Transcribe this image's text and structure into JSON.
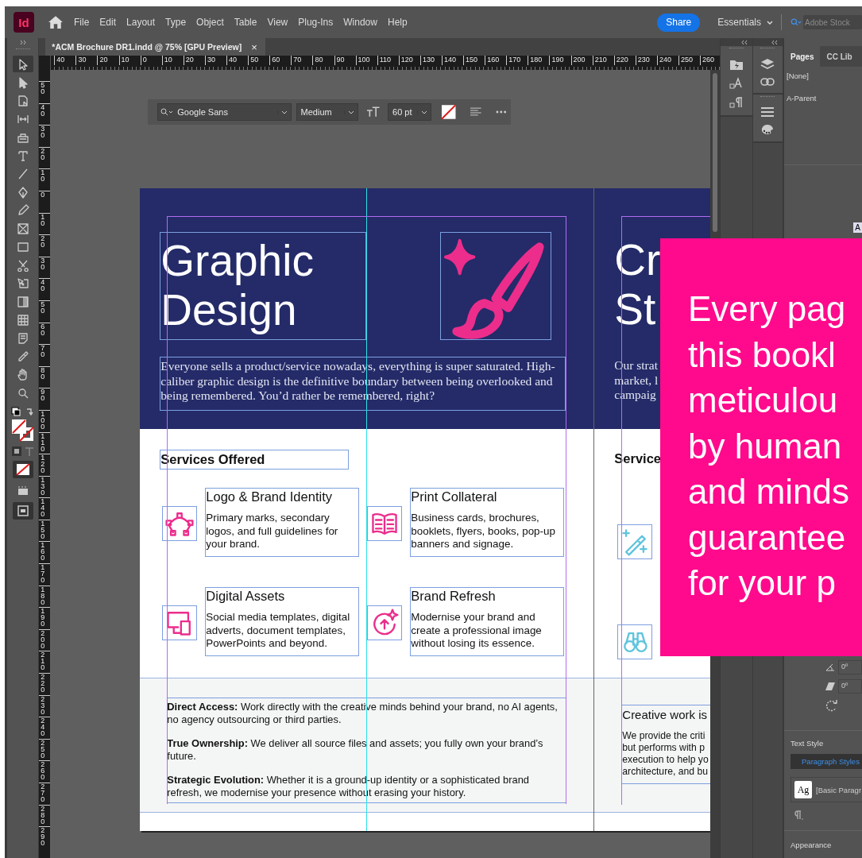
{
  "app": {
    "logo": "Id",
    "menus": [
      "File",
      "Edit",
      "Layout",
      "Type",
      "Object",
      "Table",
      "View",
      "Plug-Ins",
      "Window",
      "Help"
    ],
    "share": "Share",
    "workspace": "Essentials",
    "search_placeholder": "Adobe Stock"
  },
  "tools": [
    {
      "kind": "selection",
      "selected": true
    },
    {
      "kind": "direct-selection",
      "selected": false
    },
    {
      "kind": "page",
      "selected": false
    },
    {
      "kind": "gap",
      "selected": false
    },
    {
      "kind": "content-collector",
      "selected": false
    },
    {
      "kind": "type",
      "selected": false
    },
    {
      "kind": "line",
      "selected": false
    },
    {
      "kind": "pen",
      "selected": false
    },
    {
      "kind": "pencil",
      "selected": false
    },
    {
      "kind": "frame",
      "selected": false
    },
    {
      "kind": "rectangle",
      "selected": false
    },
    {
      "kind": "scissors",
      "selected": false
    },
    {
      "kind": "free-transform",
      "selected": false
    },
    {
      "kind": "gradient",
      "selected": false
    },
    {
      "kind": "gradient-feather",
      "selected": false
    },
    {
      "kind": "note",
      "selected": false
    },
    {
      "kind": "eyedropper",
      "selected": false
    },
    {
      "kind": "hand",
      "selected": false
    },
    {
      "kind": "zoom",
      "selected": false
    }
  ],
  "document_tab": {
    "title": "*ACM Brochure DR1.indd @ 75% [GPU Preview]",
    "close": "×"
  },
  "ruler": {
    "horizontal": [
      "40",
      "30",
      "20",
      "10",
      "0",
      "10",
      "20",
      "30",
      "40",
      "50",
      "60",
      "70",
      "80",
      "90",
      "100",
      "110",
      "120",
      "130",
      "140",
      "150",
      "160",
      "170",
      "180",
      "190",
      "200",
      "210",
      "220",
      "230",
      "240",
      "250",
      "260"
    ],
    "vertical": [
      "50",
      "40",
      "30",
      "20",
      "10",
      "0",
      "10",
      "20",
      "30",
      "40",
      "50",
      "60",
      "70",
      "80",
      "90",
      "100",
      "110",
      "120",
      "130",
      "140",
      "150",
      "160",
      "170",
      "180",
      "190",
      "200",
      "210",
      "220",
      "230",
      "240",
      "250",
      "260",
      "270",
      "280",
      "290"
    ]
  },
  "control_strip": {
    "font": "Google Sans",
    "style": "Medium",
    "size": "60 pt"
  },
  "left_page": {
    "title": "Graphic Design",
    "intro": "Everyone sells a product/service nowadays, everything is super saturated. High-caliber graphic design is the definitive boundary between being overlooked and being remembered. You’d rather be remembered, right?",
    "services_heading": "Services Offered",
    "services": [
      {
        "kind": "bezier",
        "title": "Logo & Brand Identity",
        "text": "Primary marks, secondary logos, and full guidelines for your brand."
      },
      {
        "kind": "book",
        "title": "Print Collateral",
        "text": "Business cards, brochures, booklets,  flyers, books, pop-up banners and signage."
      },
      {
        "kind": "devices",
        "title": "Digital Assets",
        "text": "Social media templates, digital adverts, document templates, PowerPoints and beyond."
      },
      {
        "kind": "refresh-sparkle",
        "title": "Brand Refresh",
        "text": "Modernise your brand and create a professional image without losing its essence."
      }
    ],
    "points": [
      "**Direct Access:** Work directly with the creative minds behind your brand, no AI agents, no agency outsourcing or third parties.",
      "**True Ownership:** We deliver all source files and assets; you fully own your brand’s future.",
      "**Strategic Evolution:** Whether it is a ground-up identity or a sophisticated brand refresh, we modernise your presence without erasing your history."
    ]
  },
  "right_page": {
    "title_lines": [
      "Cr",
      "St"
    ],
    "intro_lines": [
      "Our strat",
      "market, l",
      "campaig"
    ],
    "services_heading": "Service",
    "icons": [
      {
        "kind": "wand"
      },
      {
        "kind": "binoculars"
      }
    ],
    "feature_title": "Creative work is",
    "feature_lines": [
      "We provide the criti",
      "but performs with p",
      "execution to help yo",
      "architecture, and bu"
    ]
  },
  "overlay": {
    "lines": [
      "Every pag",
      "this bookl",
      "meticulou",
      "by human",
      "and minds",
      "guarantee",
      "for your p"
    ]
  },
  "panel": {
    "tabs": [
      {
        "label": "Pages",
        "selected": true
      },
      {
        "label": "CC Lib",
        "selected": false
      }
    ],
    "parents": [
      "[None]",
      "A-Parent"
    ],
    "page_label": "A",
    "angle": "0º",
    "shear": "0º",
    "text_style": "Text Style",
    "paragraph_styles": "Paragraph Styles",
    "style_sample": "Ag",
    "style_name": "[Basic Paragr",
    "appearance": "Appearance"
  }
}
